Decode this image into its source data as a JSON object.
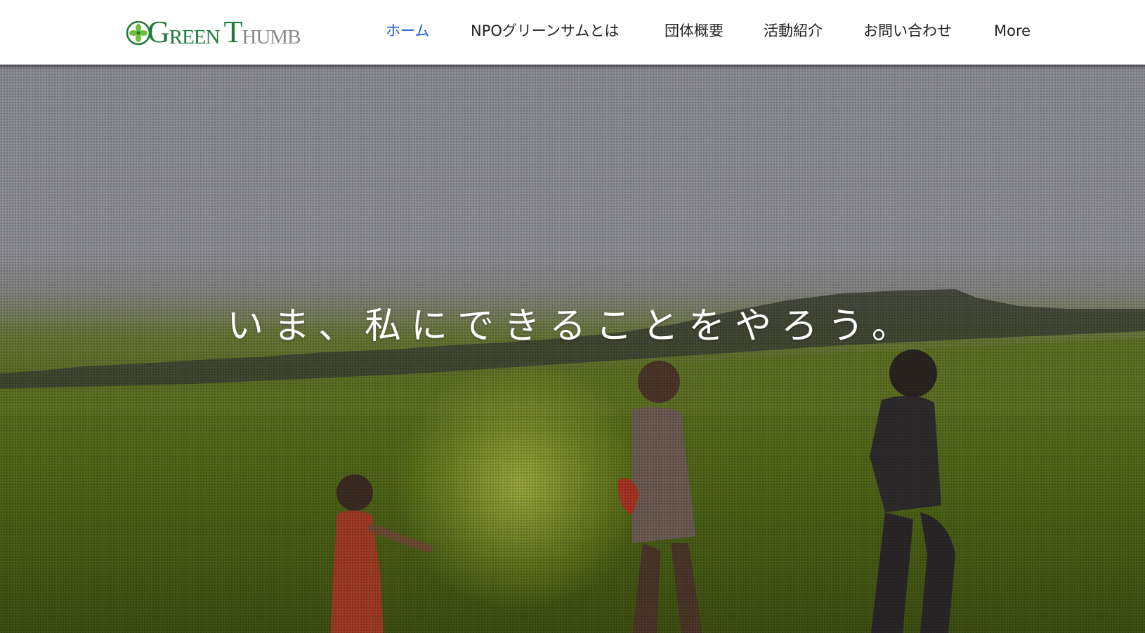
{
  "site": {
    "logo_text": "GREEN THUMB",
    "logo_parts": [
      "G",
      "REEN",
      "T",
      "HUM",
      "B"
    ]
  },
  "nav": {
    "items": [
      {
        "label": "ホーム",
        "active": true
      },
      {
        "label": "NPOグリーンサムとは",
        "active": false
      },
      {
        "label": "団体概要",
        "active": false
      },
      {
        "label": "活動紹介",
        "active": false
      },
      {
        "label": "お問い合わせ",
        "active": false
      },
      {
        "label": "More",
        "active": false
      }
    ]
  },
  "hero": {
    "tagline": "いま、私にできることをやろう。"
  },
  "colors": {
    "nav_active": "#1a5ed6",
    "nav_text": "#222222",
    "logo_green": "#1f7a3a",
    "logo_gray": "#8a8a8a"
  }
}
